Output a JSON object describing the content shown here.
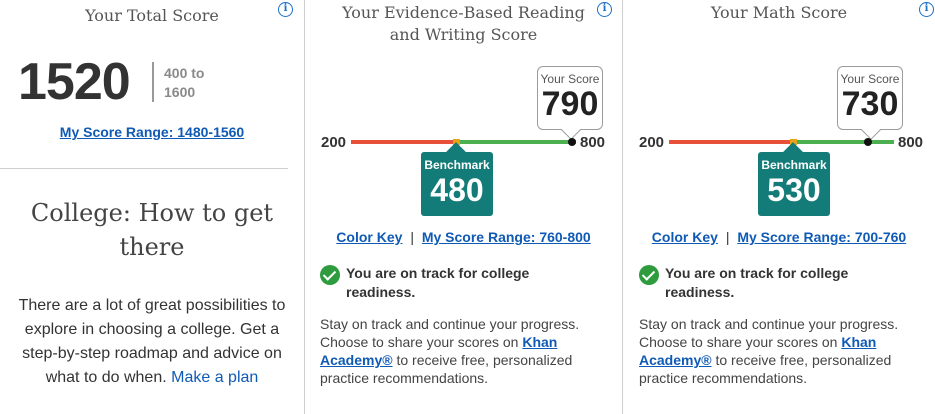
{
  "total": {
    "title": "Your Total Score",
    "score": "1520",
    "range_line1": "400 to",
    "range_line2": "1600",
    "score_range_link": "My Score Range: 1480-1560"
  },
  "college": {
    "title_line1": "College: How to get",
    "title_line2": "there",
    "body": "There are a lot of great possibilities to explore in choosing a college. Get a step-by-step roadmap and advice on what to do when.",
    "plan_link": "Make a plan"
  },
  "info_icon_glyph": "i",
  "sections": {
    "ebrw": {
      "title_line1": "Your Evidence-Based Reading",
      "title_line2": "and Writing Score",
      "scale_min": "200",
      "scale_max": "800",
      "your_score_label": "Your Score",
      "your_score": "790",
      "benchmark_label": "Benchmark",
      "benchmark": "480",
      "score_value": 790,
      "benchmark_value": 480,
      "color_key_link": "Color Key",
      "separator": "|",
      "score_range_link": "My Score Range: 760-800",
      "on_track_line1": "You are on track for college",
      "on_track_line2": "readiness.",
      "advice_prefix": "Stay on track and continue your progress. Choose to share your scores on",
      "khan_link": "Khan Academy®",
      "advice_suffix": "to receive free, personalized practice recommendations."
    },
    "math": {
      "title_line1": "Your Math Score",
      "scale_min": "200",
      "scale_max": "800",
      "your_score_label": "Your Score",
      "your_score": "730",
      "benchmark_label": "Benchmark",
      "benchmark": "530",
      "score_value": 730,
      "benchmark_value": 530,
      "color_key_link": "Color Key",
      "separator": "|",
      "score_range_link": "My Score Range: 700-760",
      "on_track_line1": "You are on track for college",
      "on_track_line2": "readiness.",
      "advice_prefix": "Stay on track and continue your progress. Choose to share your scores on",
      "khan_link": "Khan Academy®",
      "advice_suffix": "to receive free, personalized practice recommendations."
    }
  },
  "colors": {
    "below_benchmark": "#e8503a",
    "near_benchmark": "#e8a317",
    "above_benchmark": "#4caf50",
    "benchmark_box": "#137c78",
    "link": "#0f5ab5"
  }
}
